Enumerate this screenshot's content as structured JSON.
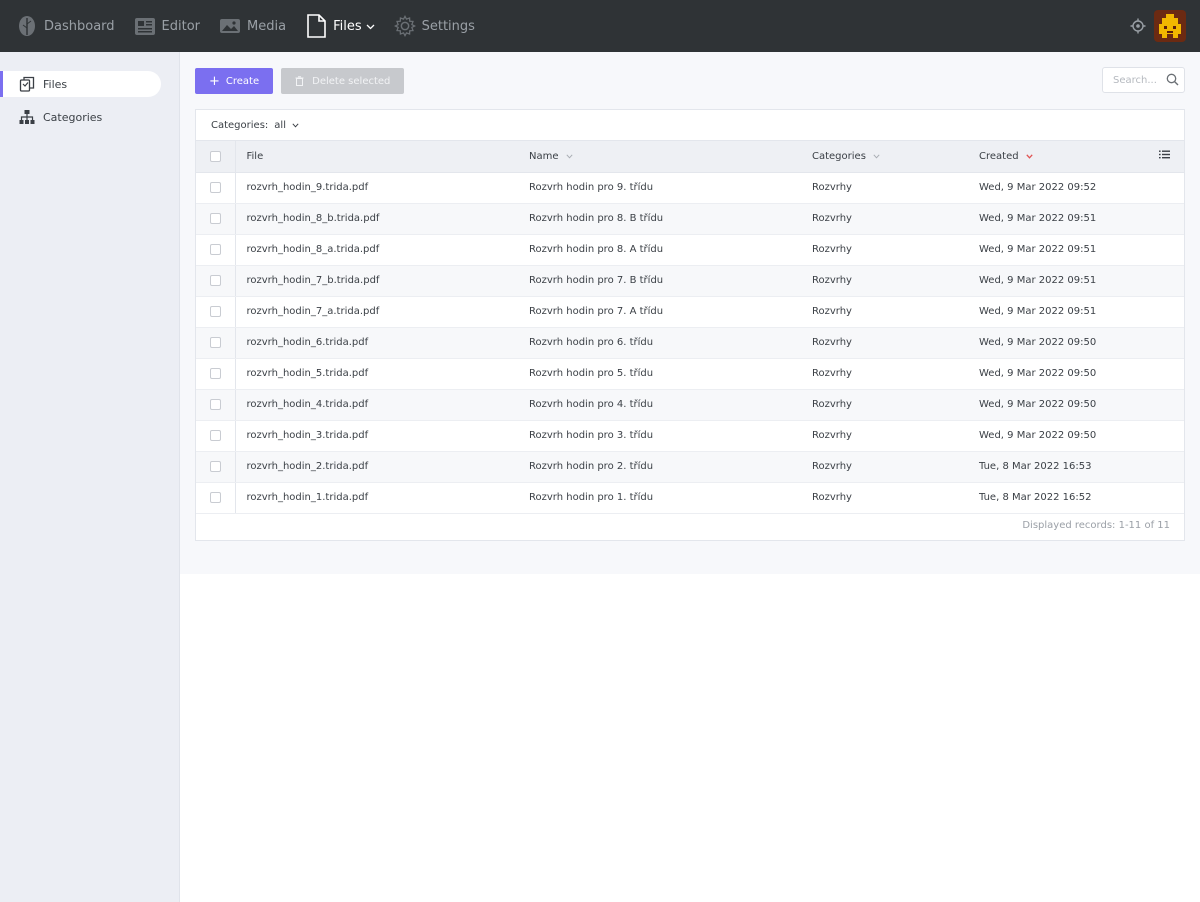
{
  "topbar": {
    "nav": [
      {
        "key": "dashboard",
        "label": "Dashboard",
        "icon": "leaf-icon"
      },
      {
        "key": "editor",
        "label": "Editor",
        "icon": "newspaper-icon"
      },
      {
        "key": "media",
        "label": "Media",
        "icon": "image-icon"
      },
      {
        "key": "files",
        "label": "Files",
        "icon": "file-icon"
      },
      {
        "key": "settings",
        "label": "Settings",
        "icon": "gear-icon"
      }
    ],
    "active": "files"
  },
  "sidebar": {
    "items": [
      {
        "label": "Files",
        "icon": "files-icon",
        "active": true
      },
      {
        "label": "Categories",
        "icon": "hierarchy-icon",
        "active": false
      }
    ]
  },
  "toolbar": {
    "create_label": "Create",
    "delete_label": "Delete selected"
  },
  "search": {
    "placeholder": "Search..."
  },
  "filter": {
    "label": "Categories:",
    "value": "all"
  },
  "table": {
    "columns": {
      "file": "File",
      "name": "Name",
      "categories": "Categories",
      "created": "Created"
    },
    "rows": [
      {
        "file": "rozvrh_hodin_9.trida.pdf",
        "name": "Rozvrh hodin pro 9. třídu",
        "category": "Rozvrhy",
        "created": "Wed, 9 Mar 2022 09:52"
      },
      {
        "file": "rozvrh_hodin_8_b.trida.pdf",
        "name": "Rozvrh hodin pro 8. B třídu",
        "category": "Rozvrhy",
        "created": "Wed, 9 Mar 2022 09:51"
      },
      {
        "file": "rozvrh_hodin_8_a.trida.pdf",
        "name": "Rozvrh hodin pro 8. A třídu",
        "category": "Rozvrhy",
        "created": "Wed, 9 Mar 2022 09:51"
      },
      {
        "file": "rozvrh_hodin_7_b.trida.pdf",
        "name": "Rozvrh hodin pro 7. B třídu",
        "category": "Rozvrhy",
        "created": "Wed, 9 Mar 2022 09:51"
      },
      {
        "file": "rozvrh_hodin_7_a.trida.pdf",
        "name": "Rozvrh hodin pro 7. A třídu",
        "category": "Rozvrhy",
        "created": "Wed, 9 Mar 2022 09:51"
      },
      {
        "file": "rozvrh_hodin_6.trida.pdf",
        "name": "Rozvrh hodin pro 6. třídu",
        "category": "Rozvrhy",
        "created": "Wed, 9 Mar 2022 09:50"
      },
      {
        "file": "rozvrh_hodin_5.trida.pdf",
        "name": "Rozvrh hodin pro 5. třídu",
        "category": "Rozvrhy",
        "created": "Wed, 9 Mar 2022 09:50"
      },
      {
        "file": "rozvrh_hodin_4.trida.pdf",
        "name": "Rozvrh hodin pro 4. třídu",
        "category": "Rozvrhy",
        "created": "Wed, 9 Mar 2022 09:50"
      },
      {
        "file": "rozvrh_hodin_3.trida.pdf",
        "name": "Rozvrh hodin pro 3. třídu",
        "category": "Rozvrhy",
        "created": "Wed, 9 Mar 2022 09:50"
      },
      {
        "file": "rozvrh_hodin_2.trida.pdf",
        "name": "Rozvrh hodin pro 2. třídu",
        "category": "Rozvrhy",
        "created": "Tue, 8 Mar 2022 16:53"
      },
      {
        "file": "rozvrh_hodin_1.trida.pdf",
        "name": "Rozvrh hodin pro 1. třídu",
        "category": "Rozvrhy",
        "created": "Tue, 8 Mar 2022 16:52"
      }
    ],
    "footer": "Displayed records: 1-11 of 11"
  },
  "colors": {
    "accent": "#7b6ff0",
    "topbar": "#2f3336",
    "sort_active": "#e05252"
  }
}
